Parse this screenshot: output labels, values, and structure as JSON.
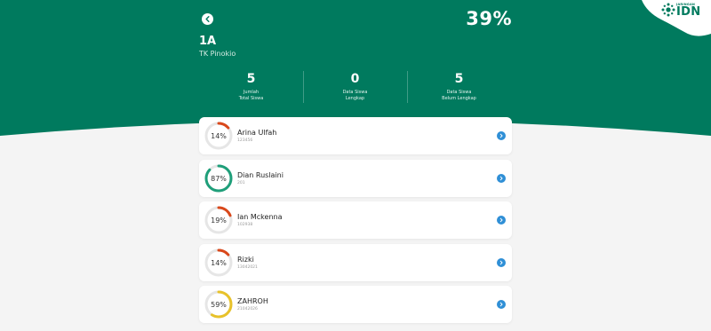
{
  "header": {
    "percent": "39%",
    "class_name": "1A",
    "school_name": "TK Pinokio"
  },
  "logo": {
    "small": "JARINGAN",
    "big": "IDN"
  },
  "stats": [
    {
      "value": "5",
      "label": "Jumlah\nTotal Siswa"
    },
    {
      "value": "0",
      "label": "Data Siswa\nLengkap"
    },
    {
      "value": "5",
      "label": "Data Siswa\nBelum Lengkap"
    }
  ],
  "students": [
    {
      "name": "Arina Ulfah",
      "id": "123456",
      "pct_text": "14%",
      "progress": 0.14,
      "color": "#d9481b"
    },
    {
      "name": "Dian Ruslaini",
      "id": "201",
      "pct_text": "87%",
      "progress": 0.87,
      "color": "#1f9f7a"
    },
    {
      "name": "Ian Mckenna",
      "id": "102938",
      "pct_text": "19%",
      "progress": 0.19,
      "color": "#d9481b"
    },
    {
      "name": "Rizki",
      "id": "13042021",
      "pct_text": "14%",
      "progress": 0.14,
      "color": "#d9481b"
    },
    {
      "name": "ZAHROH",
      "id": "21042026",
      "pct_text": "59%",
      "progress": 0.59,
      "color": "#e8c22a"
    }
  ],
  "colors": {
    "primary": "#007a5e",
    "background": "#f4f4f4",
    "arrow": "#2f8fd6",
    "ring_track": "#e6e6e6"
  },
  "icons": {
    "back": "chevron-left-icon",
    "row_arrow": "chevron-right-icon",
    "logo": "idn-logo-icon"
  }
}
